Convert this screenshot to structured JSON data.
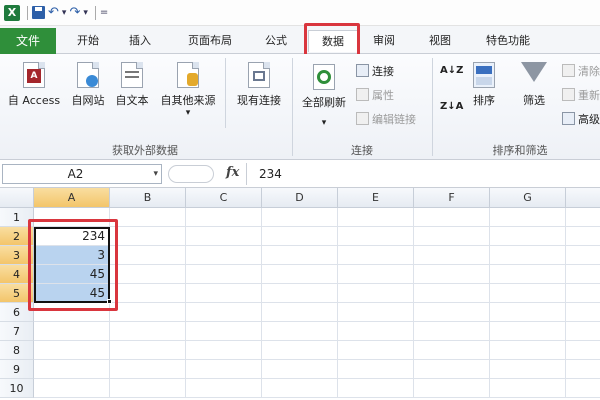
{
  "quick_access": {
    "logo": "X",
    "undo": "↶",
    "redo": "↷",
    "dropdown": "▾",
    "customize": "="
  },
  "tabs": [
    {
      "label": "文件"
    },
    {
      "label": "开始"
    },
    {
      "label": "插入"
    },
    {
      "label": "页面布局"
    },
    {
      "label": "公式"
    },
    {
      "label": "数据"
    },
    {
      "label": "审阅"
    },
    {
      "label": "视图"
    },
    {
      "label": "特色功能"
    }
  ],
  "ribbon": {
    "external": {
      "label": "获取外部数据",
      "buttons": [
        {
          "label": "自 Access",
          "badge": "A"
        },
        {
          "label": "自网站"
        },
        {
          "label": "自文本"
        },
        {
          "label": "自其他来源"
        }
      ],
      "existing": "现有连接",
      "dropdown": "▾"
    },
    "connections": {
      "label": "连接",
      "refresh": "全部刷新",
      "dropdown": "▾",
      "items": [
        "连接",
        "属性",
        "编辑链接"
      ]
    },
    "sort": {
      "label": "排序和筛选",
      "sort": "排序",
      "filter": "筛选",
      "items": [
        "清除",
        "重新",
        "高级"
      ],
      "az": "A↓Z",
      "za": "Z↓A"
    }
  },
  "formula_bar": {
    "name_box": "A2",
    "name_arrow": "▾",
    "fx": "fx",
    "value": "234"
  },
  "grid": {
    "columns": [
      "A",
      "B",
      "C",
      "D",
      "E",
      "F",
      "G"
    ],
    "rows": [
      "1",
      "2",
      "3",
      "4",
      "5",
      "6",
      "7",
      "8",
      "9",
      "10"
    ],
    "column_a_values": [
      "",
      "234",
      "3",
      "45",
      "45",
      "",
      "",
      "",
      "",
      ""
    ],
    "selection": "A2:A5"
  },
  "colors": {
    "file_tab": "#2f8f3a",
    "highlight": "#d9363e",
    "selection": "#b9d3ef",
    "active_header": "#f3c56a"
  }
}
